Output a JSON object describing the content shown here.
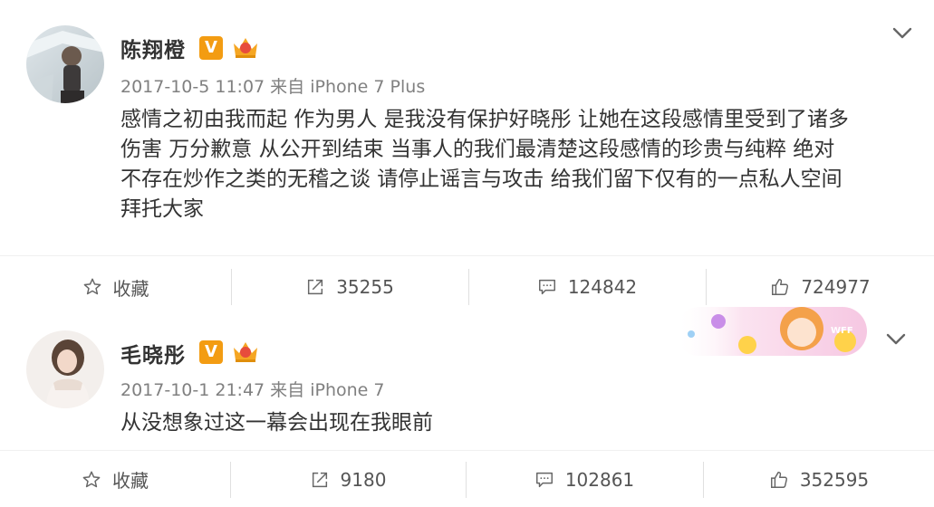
{
  "posts": [
    {
      "username": "陈翔橙",
      "verified_badge": "V",
      "date": "2017-10-5 11:07",
      "source_prefix": "来自",
      "source": "iPhone 7 Plus",
      "content_lines": [
        "感情之初由我而起 作为男人 是我没有保护好晓彤 让她在这段感情里受到了诸多",
        "伤害 万分歉意 从公开到结束 当事人的我们最清楚这段感情的珍贵与纯粹 绝对",
        "不存在炒作之类的无稽之谈 请停止谣言与攻击 给我们留下仅有的一点私人空间",
        "拜托大家"
      ],
      "actions": {
        "favorite_label": "收藏",
        "repost_count": "35255",
        "comment_count": "124842",
        "like_count": "724977"
      }
    },
    {
      "username": "毛晓彤",
      "verified_badge": "V",
      "date": "2017-10-1 21:47",
      "source_prefix": "来自",
      "source": "iPhone 7",
      "content_lines": [
        "从没想象过这一幕会出现在我眼前"
      ],
      "actions": {
        "favorite_label": "收藏",
        "repost_count": "9180",
        "comment_count": "102861",
        "like_count": "352595"
      }
    }
  ],
  "banner_text": "WFF",
  "colors": {
    "accent_badge": "#f39c12",
    "crown": "#f5a623",
    "meta_gray": "#808080",
    "text": "#333333",
    "action_gray": "#555555"
  },
  "icons": {
    "favorite": "star-icon",
    "repost": "share-arrow-icon",
    "comment": "comment-icon",
    "like": "thumbs-up-icon",
    "more": "chevron-down-icon"
  }
}
